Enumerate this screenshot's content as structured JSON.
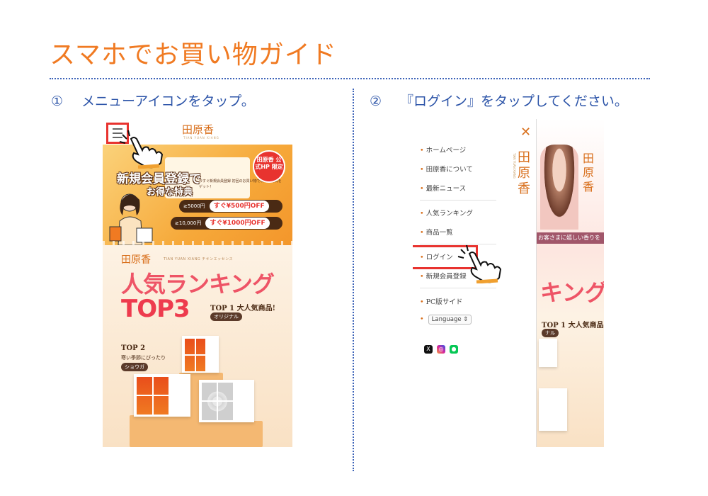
{
  "page": {
    "title": "スマホでお買い物ガイド",
    "accent_color": "#f07a22",
    "step_color": "#2c54a8",
    "highlight_color": "#e8332f"
  },
  "steps": [
    {
      "num": "①",
      "text": "メニューアイコンをタップ。"
    },
    {
      "num": "②",
      "text": "『ログイン』をタップしてください。"
    }
  ],
  "phone1": {
    "brand": "田原香",
    "brand_sub": "TIAN YUAN XIANG",
    "banner": {
      "headline": "新規会員登録で",
      "subheadline": "お得な特典",
      "note": "今すぐ新規会員登録 初回のお買い物で以下の特典をゲット！",
      "badge": "田原香 公式HP 限定",
      "promos": [
        {
          "condition": "≥5000円",
          "reward": "すぐ¥500円OFF"
        },
        {
          "condition": "≥10,000円",
          "reward": "すぐ¥1000円OFF"
        }
      ]
    },
    "ranking": {
      "brand": "田原香",
      "brand_sub": "TIAN YUAN XIANG チキンエッセンス",
      "title": "人気ランキング",
      "top3": "TOP3",
      "top1": "TOP 1 大人気商品!",
      "top1_tag": "オリジナル",
      "top2": "TOP 2",
      "top2_sub": "寒い季節にぴったり",
      "top2_tag": "ショウガ"
    }
  },
  "phone2": {
    "menu_logo": "田原香",
    "menu_items": [
      "ホームページ",
      "田原香について",
      "最新ニュース",
      "人気ランキング",
      "商品一覧",
      "ログイン",
      "新規会員登録",
      "PC版サイド"
    ],
    "language_label": "Language ⇕",
    "background_strip": "お客さまに嬉しい香りを",
    "background_rank": "キング",
    "background_top1": "TOP 1 大人気商品!",
    "background_tag": "ナル"
  }
}
